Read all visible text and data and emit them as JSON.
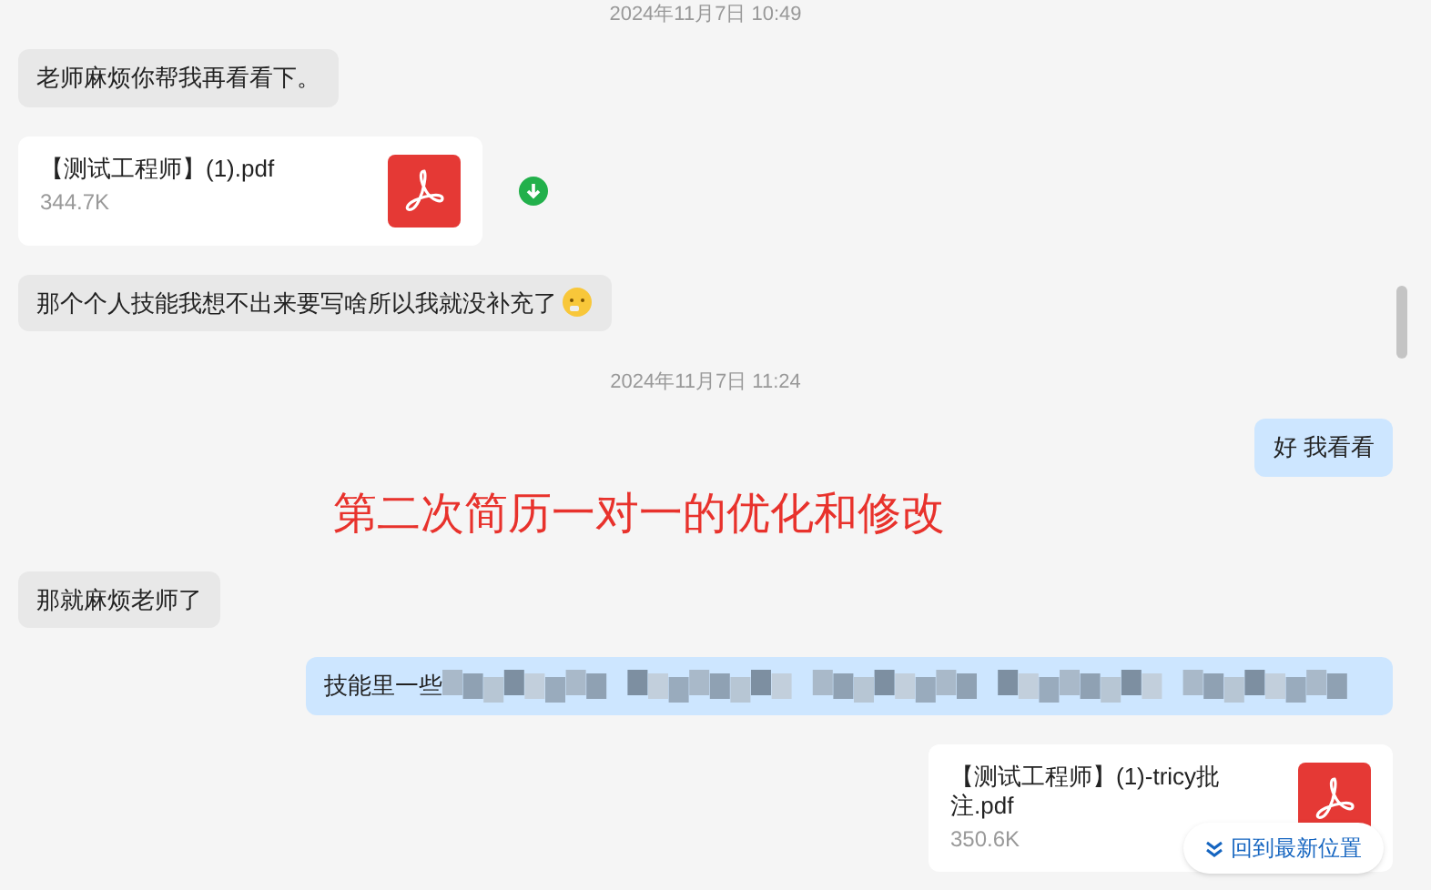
{
  "messages": [
    {
      "kind": "time",
      "text": "2024年11月7日 10:49"
    },
    {
      "kind": "text",
      "outgoing": false,
      "text": "老师麻烦你帮我再看看下。"
    },
    {
      "kind": "file",
      "outgoing": false,
      "name": "【测试工程师】(1).pdf",
      "size": "344.7K",
      "downloaded": true
    },
    {
      "kind": "text",
      "outgoing": false,
      "text": "那个个人技能我想不出来要写啥所以我就没补充了",
      "emoji": true
    },
    {
      "kind": "time",
      "text": "2024年11月7日 11:24"
    },
    {
      "kind": "text",
      "outgoing": true,
      "text": "好 我看看"
    },
    {
      "kind": "text",
      "outgoing": false,
      "text": "那就麻烦老师了"
    },
    {
      "kind": "blurred",
      "outgoing": true,
      "text": "技能里一些"
    },
    {
      "kind": "file",
      "outgoing": true,
      "name": "【测试工程师】(1)-tricy批注.pdf",
      "size": "350.6K",
      "downloaded": false
    }
  ],
  "annotation": "第二次简历一对一的优化和修改",
  "jump_button": "回到最新位置"
}
